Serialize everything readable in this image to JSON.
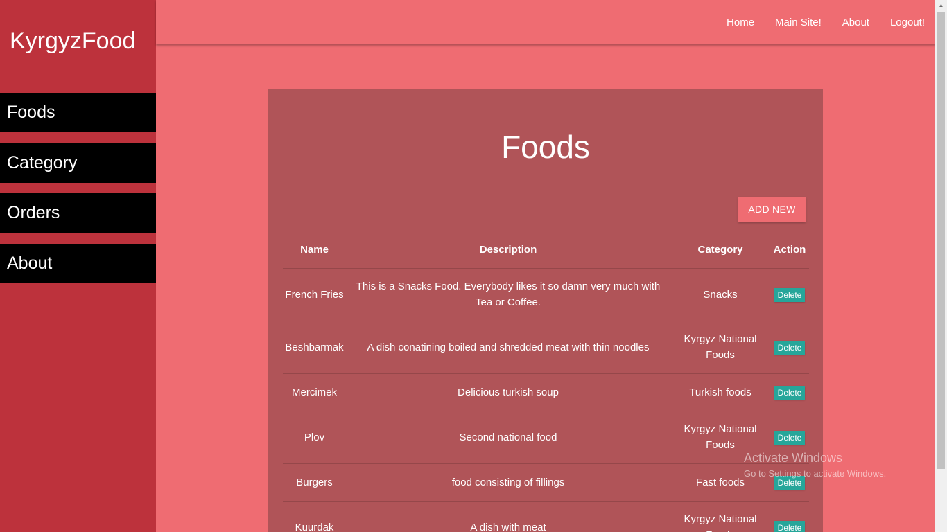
{
  "sidebar": {
    "brand": "KyrgyzFood",
    "items": [
      {
        "label": "Foods"
      },
      {
        "label": "Category"
      },
      {
        "label": "Orders"
      },
      {
        "label": "About"
      }
    ]
  },
  "topnav": {
    "items": [
      {
        "label": "Home"
      },
      {
        "label": "Main Site!"
      },
      {
        "label": "About"
      },
      {
        "label": "Logout!"
      }
    ]
  },
  "main": {
    "title": "Foods",
    "add_button": "ADD NEW",
    "table": {
      "headers": [
        "Name",
        "Description",
        "Category",
        "Action"
      ],
      "rows": [
        {
          "name": "French Fries",
          "description": "This is a Snacks Food. Everybody likes it so damn very much with Tea or Coffee.",
          "category": "Snacks",
          "action": "Delete"
        },
        {
          "name": "Beshbarmak",
          "description": "A dish conatining boiled and shredded meat with thin noodles",
          "category": "Kyrgyz National Foods",
          "action": "Delete"
        },
        {
          "name": "Mercimek",
          "description": "Delicious turkish soup",
          "category": "Turkish foods",
          "action": "Delete"
        },
        {
          "name": "Plov",
          "description": "Second national food",
          "category": "Kyrgyz National Foods",
          "action": "Delete"
        },
        {
          "name": "Burgers",
          "description": "food consisting of fillings",
          "category": "Fast foods",
          "action": "Delete"
        },
        {
          "name": "Kuurdak",
          "description": "A dish with meat",
          "category": "Kyrgyz National Foods",
          "action": "Delete"
        }
      ]
    }
  },
  "watermark": {
    "title": "Activate Windows",
    "subtitle": "Go to Settings to activate Windows."
  },
  "colors": {
    "page_bg": "#ef6c72",
    "sidebar_bg": "#bd323c",
    "card_bg": "#b05458",
    "delete_button": "#26a69a"
  }
}
